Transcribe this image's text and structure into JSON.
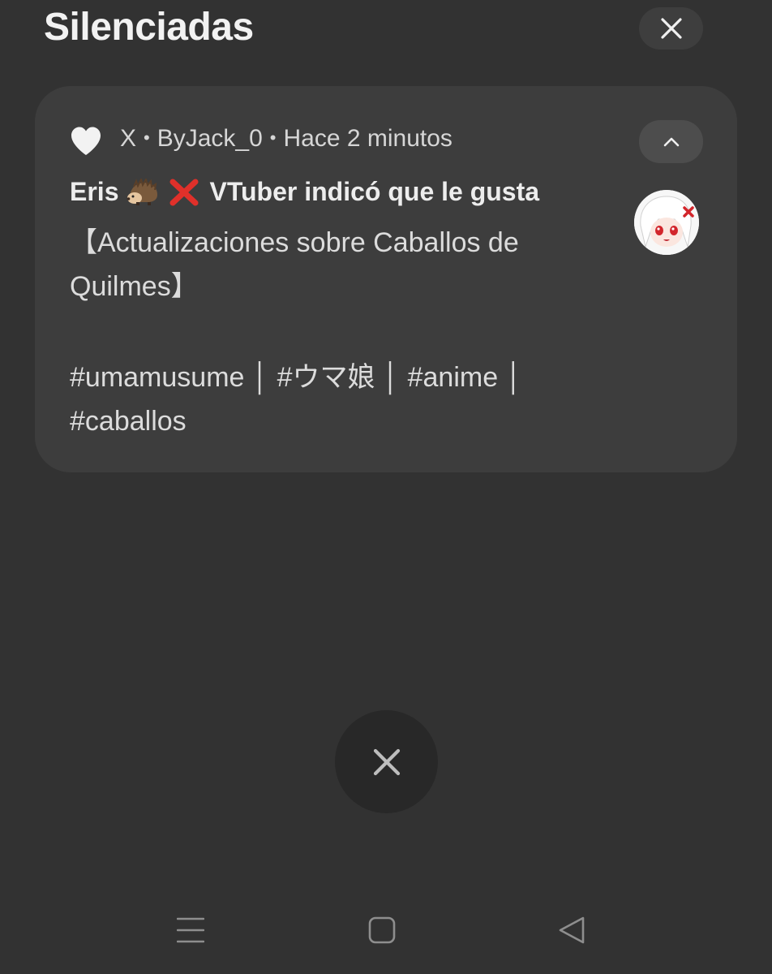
{
  "header": {
    "title": "Silenciadas",
    "close_icon": "close-icon"
  },
  "notification": {
    "app_icon": "heart-icon",
    "app_name": "X",
    "separator": "•",
    "account": "ByJack_0",
    "time": "Hace 2 minutos",
    "expand_icon": "chevron-up-icon",
    "title_name": "Eris",
    "title_emojis": [
      "hedgehog-emoji",
      "cross-mark-emoji"
    ],
    "title_rest": "VTuber indicó que le gusta",
    "body_line1": "【Actualizaciones sobre Caballos de",
    "body_line2": "Quilmes】",
    "body_line3": "#umamusume │ #ウマ娘 │ #anime │",
    "body_line4": "#caballos",
    "avatar": "avatar-image"
  },
  "dismiss_button": {
    "icon": "close-icon"
  },
  "navigation_bar": {
    "recents_icon": "recents-icon",
    "home_icon": "home-icon",
    "back_icon": "back-icon"
  },
  "colors": {
    "background": "#323232",
    "card": "#3d3d3d",
    "button": "#4d4d4d",
    "text_primary": "#ededed",
    "text_secondary": "#d6d6d6",
    "fab": "#282828"
  }
}
